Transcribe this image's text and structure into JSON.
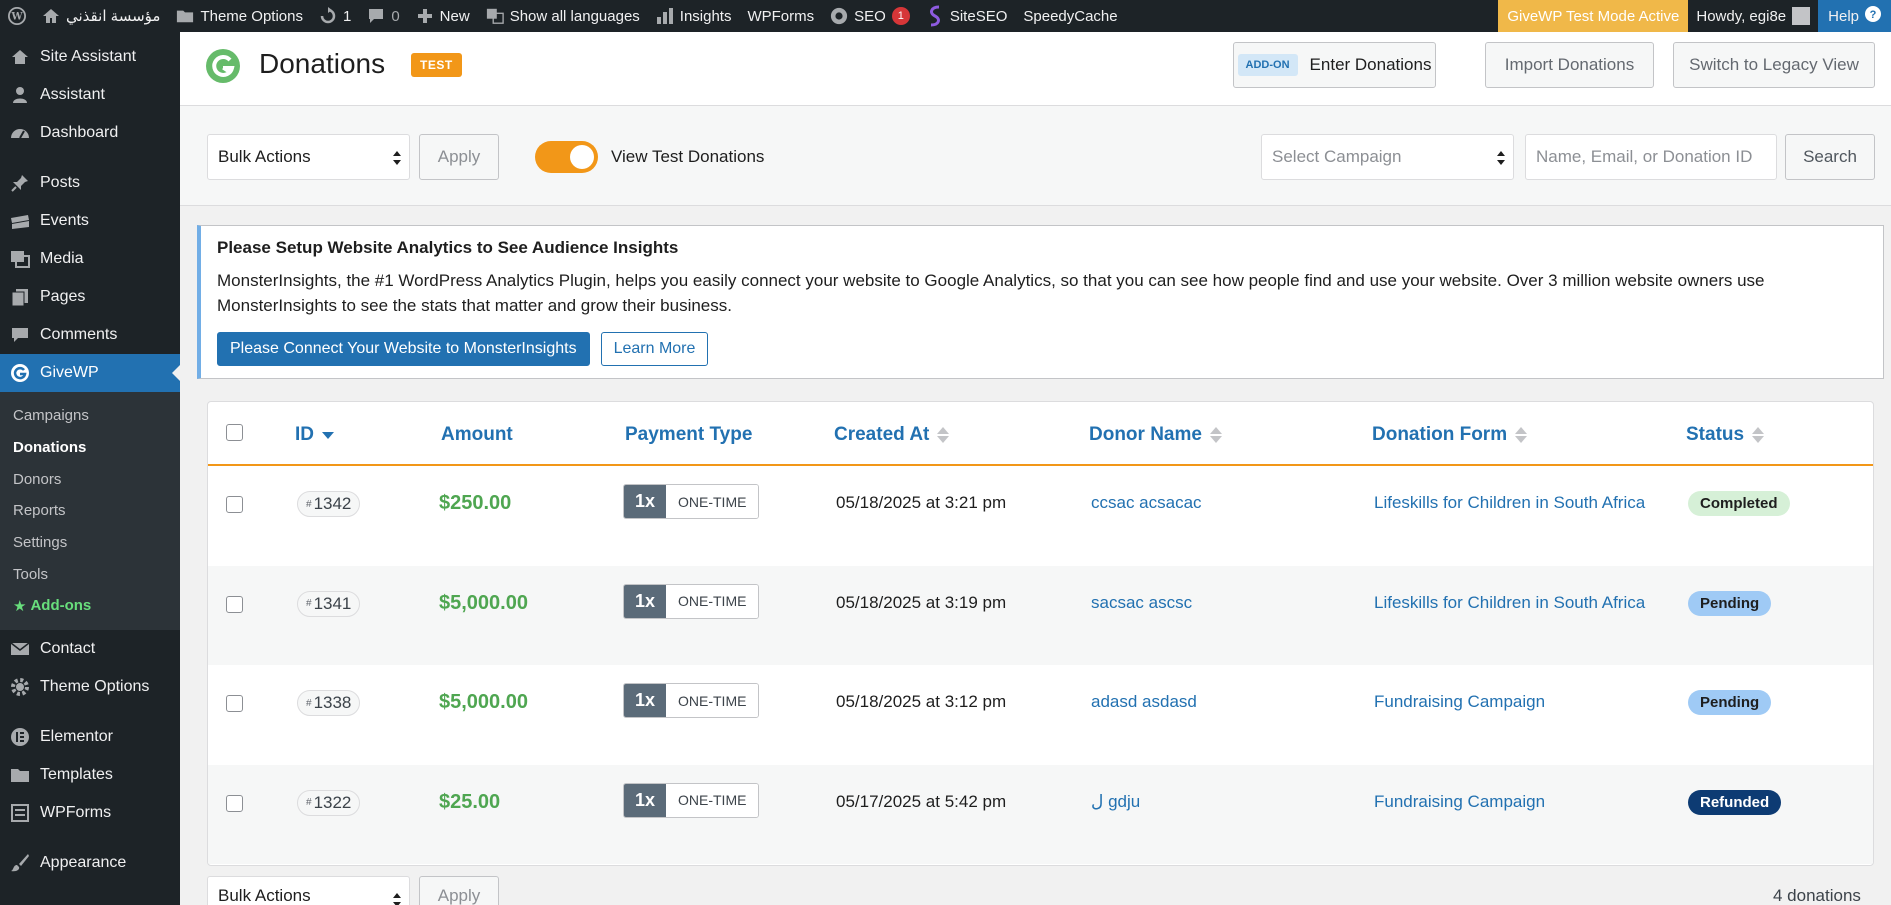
{
  "adminbar": {
    "site_name": "مؤسسة انقذني",
    "theme_options": "Theme Options",
    "updates_count": "1",
    "comments_count": "0",
    "new": "New",
    "show_languages": "Show all languages",
    "insights": "Insights",
    "wpforms": "WPForms",
    "seo": "SEO",
    "seo_badge": "1",
    "siteseo": "SiteSEO",
    "speedycache": "SpeedyCache",
    "test_mode": "GiveWP Test Mode Active",
    "howdy": "Howdy, egi8e",
    "help": "Help"
  },
  "sidebar": {
    "items_top": [
      {
        "label": "Site Assistant",
        "icon": "home-icon"
      },
      {
        "label": "Assistant",
        "icon": "user-icon"
      },
      {
        "label": "Dashboard",
        "icon": "dashboard-icon"
      }
    ],
    "items_mid": [
      {
        "label": "Posts",
        "icon": "pin-icon"
      },
      {
        "label": "Events",
        "icon": "events-icon"
      },
      {
        "label": "Media",
        "icon": "media-icon"
      },
      {
        "label": "Pages",
        "icon": "pages-icon"
      },
      {
        "label": "Comments",
        "icon": "comment-icon"
      }
    ],
    "active": {
      "label": "GiveWP",
      "icon": "givewp-icon"
    },
    "submenu": [
      "Campaigns",
      "Donations",
      "Donors",
      "Reports",
      "Settings",
      "Tools",
      "Add-ons"
    ],
    "items_bottom": [
      {
        "label": "Contact",
        "icon": "mail-icon"
      },
      {
        "label": "Theme Options",
        "icon": "gear-icon"
      },
      {
        "label": "Elementor",
        "icon": "elementor-icon"
      },
      {
        "label": "Templates",
        "icon": "folder-icon"
      },
      {
        "label": "WPForms",
        "icon": "form-icon"
      },
      {
        "label": "Appearance",
        "icon": "brush-icon"
      }
    ]
  },
  "header": {
    "title": "Donations",
    "test_badge": "TEST",
    "addon_tag": "ADD-ON",
    "enter_donations": "Enter Donations",
    "import_donations": "Import Donations",
    "legacy_view": "Switch to Legacy View"
  },
  "filters": {
    "bulk_actions": "Bulk Actions",
    "apply": "Apply",
    "view_test": "View Test Donations",
    "select_campaign": "Select Campaign",
    "search_placeholder": "Name, Email, or Donation ID",
    "search": "Search"
  },
  "notice": {
    "title": "Please Setup Website Analytics to See Audience Insights",
    "text": "MonsterInsights, the #1 WordPress Analytics Plugin, helps you easily connect your website to Google Analytics, so that you can see how people find and use your website. Over 3 million website owners use MonsterInsights to see the stats that matter and grow their business.",
    "connect_button": "Please Connect Your Website to MonsterInsights",
    "learn_more": "Learn More"
  },
  "table": {
    "headers": {
      "id": "ID",
      "amount": "Amount",
      "payment_type": "Payment Type",
      "created_at": "Created At",
      "donor_name": "Donor Name",
      "donation_form": "Donation Form",
      "status": "Status"
    },
    "rows": [
      {
        "id": "1342",
        "amount": "$250.00",
        "freq": "1x",
        "ptype": "ONE-TIME",
        "created": "05/18/2025 at 3:21 pm",
        "donor": "ccsac acsacac",
        "form": "Lifeskills for Children in South Africa",
        "status": "Completed",
        "status_class": "completed"
      },
      {
        "id": "1341",
        "amount": "$5,000.00",
        "freq": "1x",
        "ptype": "ONE-TIME",
        "created": "05/18/2025 at 3:19 pm",
        "donor": "sacsac ascsc",
        "form": "Lifeskills for Children in South Africa",
        "status": "Pending",
        "status_class": "pending"
      },
      {
        "id": "1338",
        "amount": "$5,000.00",
        "freq": "1x",
        "ptype": "ONE-TIME",
        "created": "05/18/2025 at 3:12 pm",
        "donor": "adasd asdasd",
        "form": "Fundraising Campaign",
        "status": "Pending",
        "status_class": "pending"
      },
      {
        "id": "1322",
        "amount": "$25.00",
        "freq": "1x",
        "ptype": "ONE-TIME",
        "created": "05/17/2025 at 5:42 pm",
        "donor": "ل gdju",
        "form": "Fundraising Campaign",
        "status": "Refunded",
        "status_class": "refunded"
      }
    ]
  },
  "footer": {
    "bulk_actions": "Bulk Actions",
    "apply": "Apply",
    "count": "4 donations"
  },
  "colors": {
    "accent": "#2271b1",
    "givewp_orange": "#f29718",
    "amount_green": "#4fa651"
  }
}
